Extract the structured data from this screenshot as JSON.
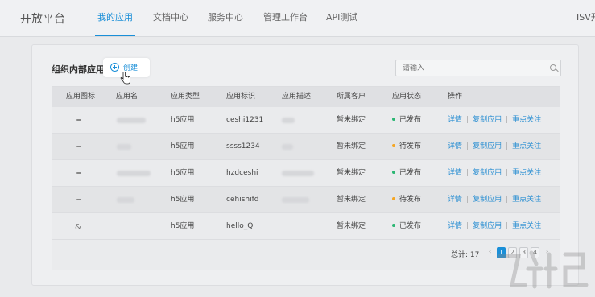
{
  "header": {
    "brand": "开放平台",
    "nav": [
      {
        "label": "我的应用",
        "active": true
      },
      {
        "label": "文档中心",
        "active": false
      },
      {
        "label": "服务中心",
        "active": false
      },
      {
        "label": "管理工作台",
        "active": false
      },
      {
        "label": "API测试",
        "active": false
      }
    ],
    "isv": "ISV开"
  },
  "section": {
    "title": "组织内部应用",
    "create_label": "创建",
    "search_placeholder": "请输入"
  },
  "table": {
    "columns": [
      "应用图标",
      "应用名",
      "应用类型",
      "应用标识",
      "应用描述",
      "所属客户",
      "应用状态",
      "操作"
    ],
    "rows": [
      {
        "icon": "dash",
        "type": "h5应用",
        "id": "ceshi1231",
        "customer": "暂未绑定",
        "status": "已发布",
        "status_color": "#2bb673"
      },
      {
        "icon": "dash",
        "type": "h5应用",
        "id": "ssss1234",
        "customer": "暂未绑定",
        "status": "待发布",
        "status_color": "#f5a623"
      },
      {
        "icon": "dash",
        "type": "h5应用",
        "id": "hzdceshi",
        "customer": "暂未绑定",
        "status": "已发布",
        "status_color": "#2bb673"
      },
      {
        "icon": "dash",
        "type": "h5应用",
        "id": "cehishifd",
        "customer": "暂未绑定",
        "status": "待发布",
        "status_color": "#f5a623"
      },
      {
        "icon": "glyph",
        "type": "h5应用",
        "id": "hello_Q",
        "customer": "暂未绑定",
        "status": "已发布",
        "status_color": "#2bb673"
      }
    ],
    "actions": [
      "详情",
      "复制应用",
      "重点关注"
    ]
  },
  "pagination": {
    "total_label": "总计: 17",
    "pages": [
      "1",
      "2",
      "3",
      "4"
    ],
    "current": "1"
  },
  "colors": {
    "accent": "#1a8fd8",
    "published": "#2bb673",
    "pending": "#f5a623"
  }
}
